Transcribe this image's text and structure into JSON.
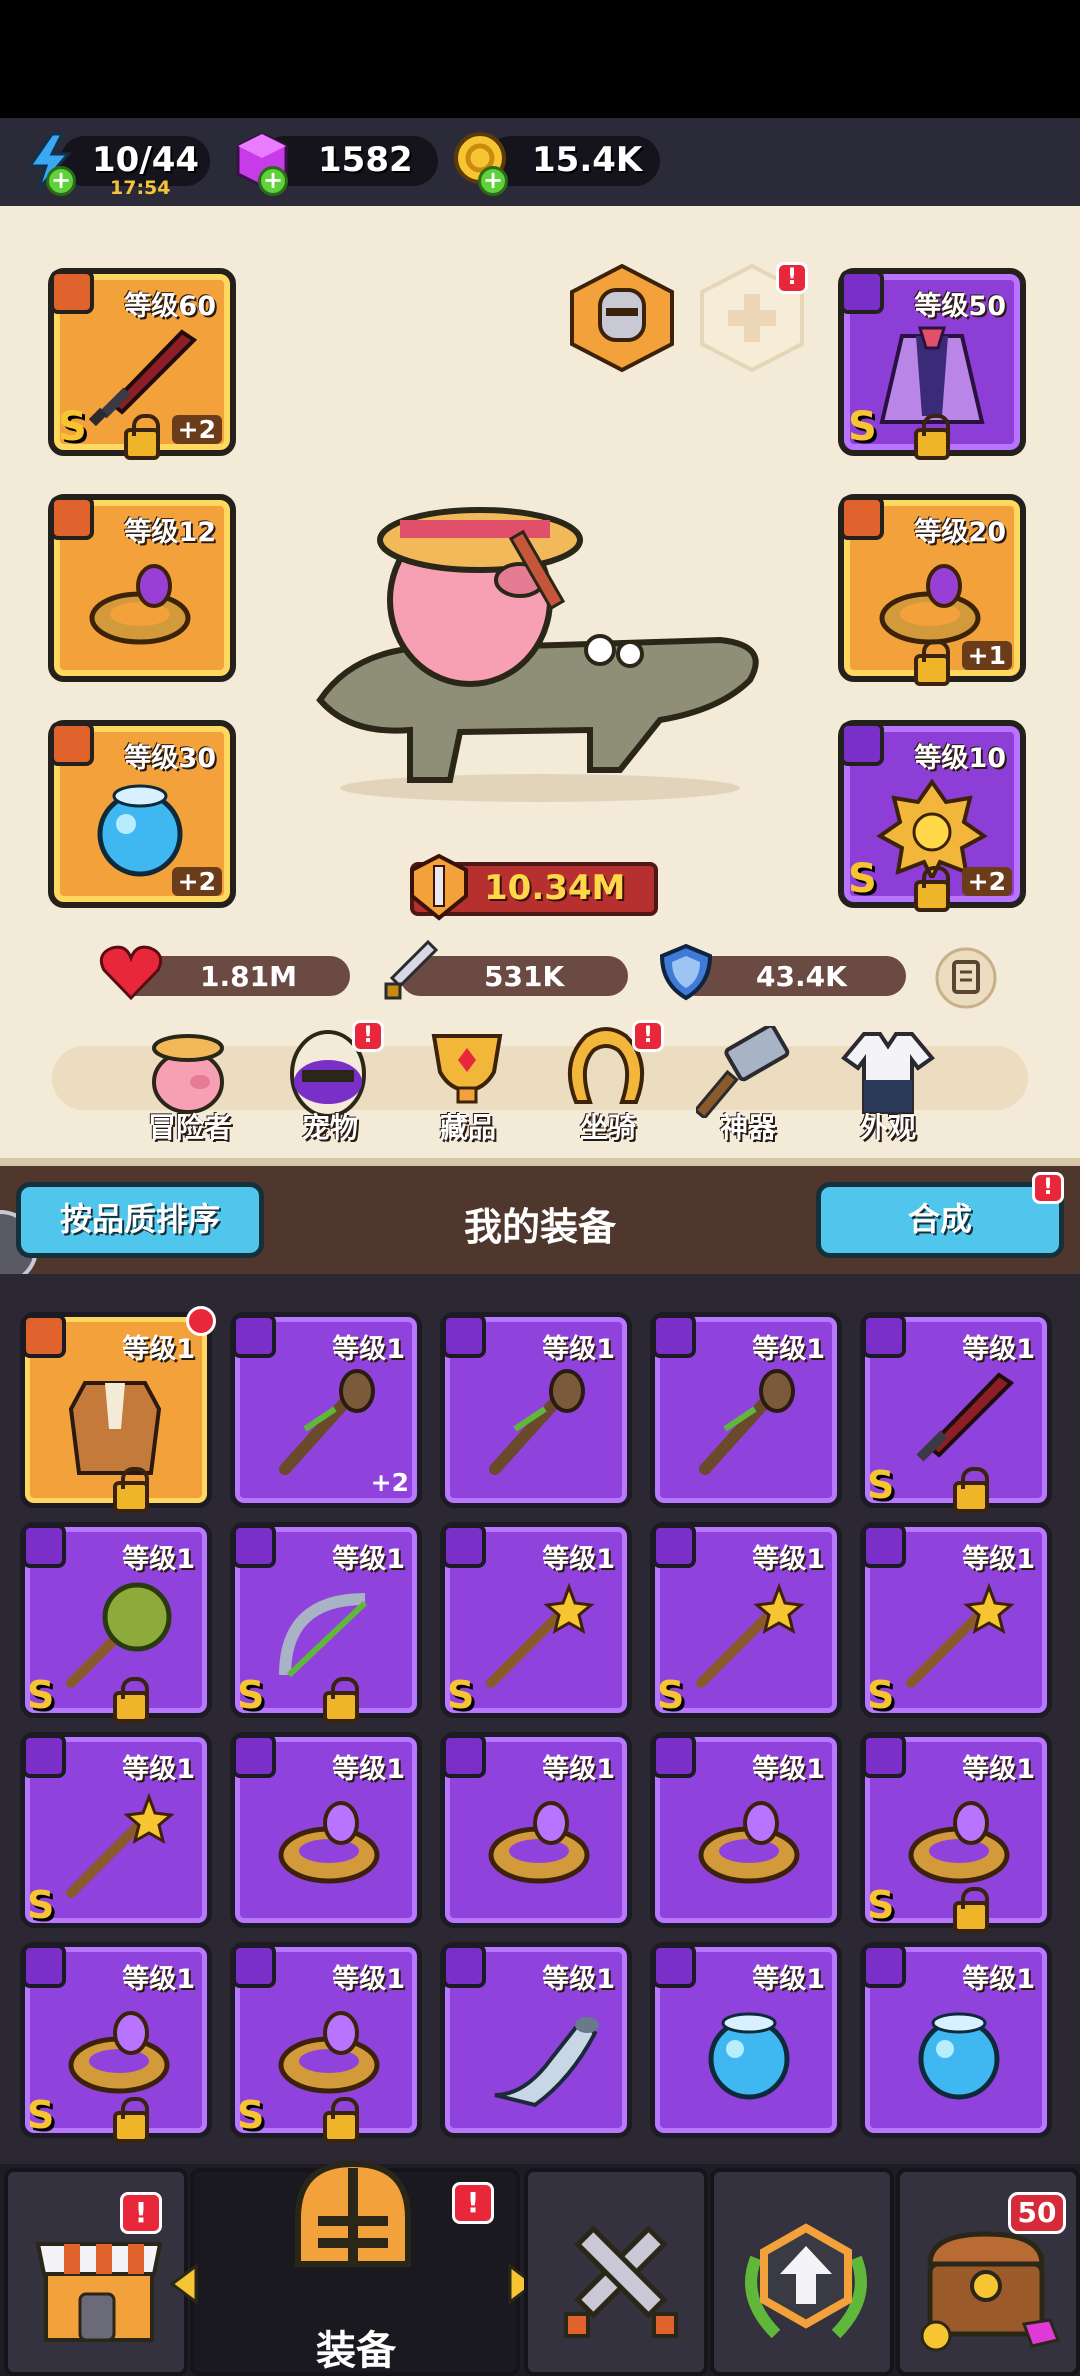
{
  "resources": {
    "energy": {
      "value": "10/44",
      "timer": "17:54"
    },
    "gems": {
      "value": "1582"
    },
    "gold": {
      "value": "15.4K"
    }
  },
  "equipped": {
    "left": [
      {
        "level": "等级60",
        "grade": "S",
        "plus": "+2",
        "item": "sword"
      },
      {
        "level": "等级12",
        "grade": "",
        "plus": "",
        "item": "ring"
      },
      {
        "level": "等级30",
        "grade": "",
        "plus": "+2",
        "item": "orb"
      }
    ],
    "right": [
      {
        "level": "等级50",
        "grade": "S",
        "plus": "",
        "item": "cloak"
      },
      {
        "level": "等级20",
        "grade": "",
        "plus": "+1",
        "item": "ring"
      },
      {
        "level": "等级10",
        "grade": "S",
        "plus": "+2",
        "item": "medal"
      }
    ]
  },
  "power": "10.34M",
  "stats": {
    "hp": "1.81M",
    "attack": "531K",
    "defense": "43.4K"
  },
  "nav_tabs": [
    "冒险者",
    "宠物",
    "藏品",
    "坐骑",
    "神器",
    "外观"
  ],
  "header": {
    "sort_button": "按品质排序",
    "title": "我的装备",
    "merge_button": "合成"
  },
  "inventory": [
    {
      "level": "等级1",
      "grade": "",
      "plus": "",
      "rarity": "orange",
      "item": "armor",
      "lock": true
    },
    {
      "level": "等级1",
      "grade": "",
      "plus": "+2",
      "rarity": "purple",
      "item": "staff",
      "lock": false
    },
    {
      "level": "等级1",
      "grade": "",
      "plus": "",
      "rarity": "purple",
      "item": "staff",
      "lock": false
    },
    {
      "level": "等级1",
      "grade": "",
      "plus": "",
      "rarity": "purple",
      "item": "staff",
      "lock": false
    },
    {
      "level": "等级1",
      "grade": "S",
      "plus": "",
      "rarity": "purple",
      "item": "sword",
      "lock": true
    },
    {
      "level": "等级1",
      "grade": "S",
      "plus": "",
      "rarity": "purple",
      "item": "mace",
      "lock": true
    },
    {
      "level": "等级1",
      "grade": "S",
      "plus": "",
      "rarity": "purple",
      "item": "bow",
      "lock": true
    },
    {
      "level": "等级1",
      "grade": "S",
      "plus": "",
      "rarity": "purple",
      "item": "wand",
      "lock": false
    },
    {
      "level": "等级1",
      "grade": "S",
      "plus": "",
      "rarity": "purple",
      "item": "wand",
      "lock": false
    },
    {
      "level": "等级1",
      "grade": "S",
      "plus": "",
      "rarity": "purple",
      "item": "wand",
      "lock": false
    },
    {
      "level": "等级1",
      "grade": "S",
      "plus": "",
      "rarity": "purple",
      "item": "wand",
      "lock": false
    },
    {
      "level": "等级1",
      "grade": "",
      "plus": "",
      "rarity": "purple",
      "item": "ring",
      "lock": false
    },
    {
      "level": "等级1",
      "grade": "",
      "plus": "",
      "rarity": "purple",
      "item": "ring",
      "lock": false
    },
    {
      "level": "等级1",
      "grade": "",
      "plus": "",
      "rarity": "purple",
      "item": "ring",
      "lock": false
    },
    {
      "level": "等级1",
      "grade": "S",
      "plus": "",
      "rarity": "purple",
      "item": "ring",
      "lock": true
    },
    {
      "level": "等级1",
      "grade": "S",
      "plus": "",
      "rarity": "purple",
      "item": "ring",
      "lock": true
    },
    {
      "level": "等级1",
      "grade": "S",
      "plus": "",
      "rarity": "purple",
      "item": "ring",
      "lock": true
    },
    {
      "level": "等级1",
      "grade": "",
      "plus": "",
      "rarity": "purple",
      "item": "horn",
      "lock": false
    },
    {
      "level": "等级1",
      "grade": "",
      "plus": "",
      "rarity": "purple",
      "item": "orb",
      "lock": false
    },
    {
      "level": "等级1",
      "grade": "",
      "plus": "",
      "rarity": "purple",
      "item": "orb",
      "lock": false
    }
  ],
  "bottom_nav": {
    "active_label": "装备",
    "chest_count": "50"
  },
  "badges": {
    "exclaim": "!"
  }
}
